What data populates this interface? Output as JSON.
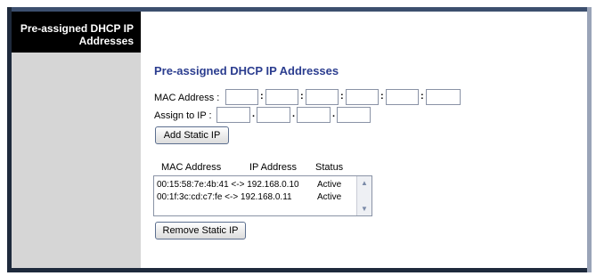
{
  "sidebar": {
    "title": "Pre-assigned DHCP IP Addresses"
  },
  "main": {
    "heading": "Pre-assigned DHCP IP Addresses",
    "mac_label": "MAC Address :",
    "ip_label": "Assign to IP :",
    "mac_sep": ":",
    "ip_sep": ".",
    "mac_fields": [
      "",
      "",
      "",
      "",
      "",
      ""
    ],
    "ip_fields": [
      "",
      "",
      "",
      ""
    ],
    "add_button": "Add Static IP",
    "remove_button": "Remove Static IP"
  },
  "list": {
    "columns": [
      "MAC Address",
      "IP Address",
      "Status"
    ],
    "rows": [
      {
        "entry": "00:15:58:7e:4b:41 <-> 192.168.0.10",
        "status": "Active"
      },
      {
        "entry": "00:1f:3c:cd:c7:fe <-> 192.168.0.11",
        "status": "Active"
      }
    ]
  },
  "icons": {
    "scroll_up": "arrow-up-icon",
    "scroll_down": "arrow-down-icon"
  },
  "colors": {
    "heading": "#2b3d8f",
    "sidebar_title_bg": "#000000",
    "frame": "#1e2a3c"
  }
}
